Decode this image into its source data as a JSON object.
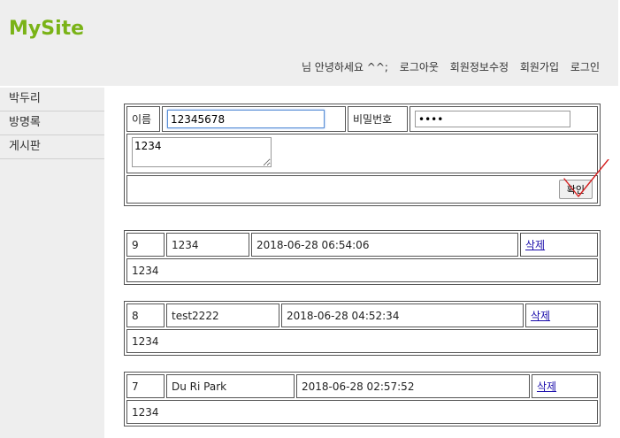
{
  "site": {
    "brand": "MySite"
  },
  "topnav": {
    "greeting": "님 안녕하세요 ^^;",
    "links": [
      "로그아웃",
      "회원정보수정",
      "회원가입",
      "로그인"
    ]
  },
  "sidebar": {
    "items": [
      "박두리",
      "방명록",
      "게시판"
    ]
  },
  "form": {
    "name_label": "이름",
    "name_value": "12345678",
    "password_label": "비밀번호",
    "password_value": "••••",
    "content_value": "1234",
    "submit_label": "확인"
  },
  "entries": [
    {
      "no": "9",
      "name": "1234",
      "date": "2018-06-28 06:54:06",
      "delete_label": "삭제",
      "content": "1234"
    },
    {
      "no": "8",
      "name": "test2222",
      "date": "2018-06-28 04:52:34",
      "delete_label": "삭제",
      "content": "1234"
    },
    {
      "no": "7",
      "name": "Du Ri Park",
      "date": "2018-06-28 02:57:52",
      "delete_label": "삭제",
      "content": "1234"
    }
  ],
  "colors": {
    "brand": "#7ab317",
    "chrome_bg": "#eeeeee",
    "link": "#1a0dab",
    "check_mark": "#d62020"
  }
}
